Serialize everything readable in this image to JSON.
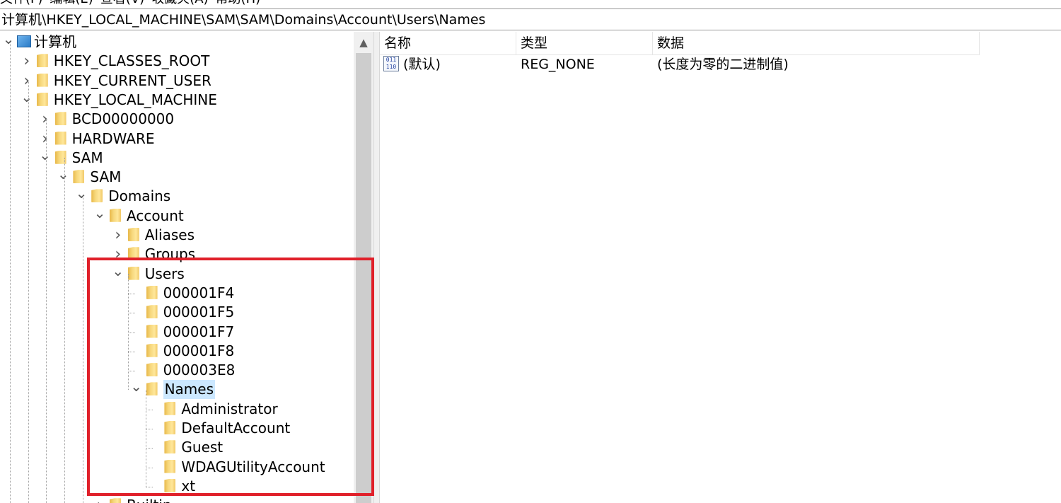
{
  "menubar": {
    "items": [
      "文件(F)",
      "编辑(E)",
      "查看(V)",
      "收藏夹(A)",
      "帮助(H)"
    ]
  },
  "address": "计算机\\HKEY_LOCAL_MACHINE\\SAM\\SAM\\Domains\\Account\\Users\\Names",
  "tree": [
    {
      "label": "计算机",
      "expanded": true,
      "icon": "computer-icon"
    },
    {
      "label": "HKEY_CLASSES_ROOT",
      "expanded": false,
      "icon": "folder-icon"
    },
    {
      "label": "HKEY_CURRENT_USER",
      "expanded": false,
      "icon": "folder-icon"
    },
    {
      "label": "HKEY_LOCAL_MACHINE",
      "expanded": true,
      "icon": "folder-icon"
    },
    {
      "label": "BCD00000000",
      "expanded": false,
      "icon": "folder-icon"
    },
    {
      "label": "HARDWARE",
      "expanded": false,
      "icon": "folder-icon"
    },
    {
      "label": "SAM",
      "expanded": true,
      "icon": "folder-icon"
    },
    {
      "label": "SAM",
      "expanded": true,
      "icon": "folder-icon"
    },
    {
      "label": "Domains",
      "expanded": true,
      "icon": "folder-icon"
    },
    {
      "label": "Account",
      "expanded": true,
      "icon": "folder-icon"
    },
    {
      "label": "Aliases",
      "expanded": false,
      "icon": "folder-icon"
    },
    {
      "label": "Groups",
      "expanded": false,
      "icon": "folder-icon"
    },
    {
      "label": "Users",
      "expanded": true,
      "icon": "folder-icon"
    },
    {
      "label": "000001F4",
      "icon": "folder-icon"
    },
    {
      "label": "000001F5",
      "icon": "folder-icon"
    },
    {
      "label": "000001F7",
      "icon": "folder-icon"
    },
    {
      "label": "000001F8",
      "icon": "folder-icon"
    },
    {
      "label": "000003E8",
      "icon": "folder-icon"
    },
    {
      "label": "Names",
      "expanded": true,
      "selected": true,
      "icon": "folder-icon"
    },
    {
      "label": "Administrator",
      "icon": "folder-icon"
    },
    {
      "label": "DefaultAccount",
      "icon": "folder-icon"
    },
    {
      "label": "Guest",
      "icon": "folder-icon"
    },
    {
      "label": "WDAGUtilityAccount",
      "icon": "folder-icon"
    },
    {
      "label": "xt",
      "icon": "folder-icon"
    },
    {
      "label": "Builtin",
      "expanded": false,
      "icon": "folder-icon"
    }
  ],
  "list": {
    "columns": {
      "name": "名称",
      "type": "类型",
      "data": "数据"
    },
    "rows": [
      {
        "name": "(默认)",
        "type": "REG_NONE",
        "data": "(长度为零的二进制值)",
        "icon": "binary-value-icon",
        "icon_text": "011\n110"
      }
    ]
  },
  "colors": {
    "selection": "#cce8ff",
    "highlight_box": "#e0202a",
    "folder": "#f6d77b"
  }
}
